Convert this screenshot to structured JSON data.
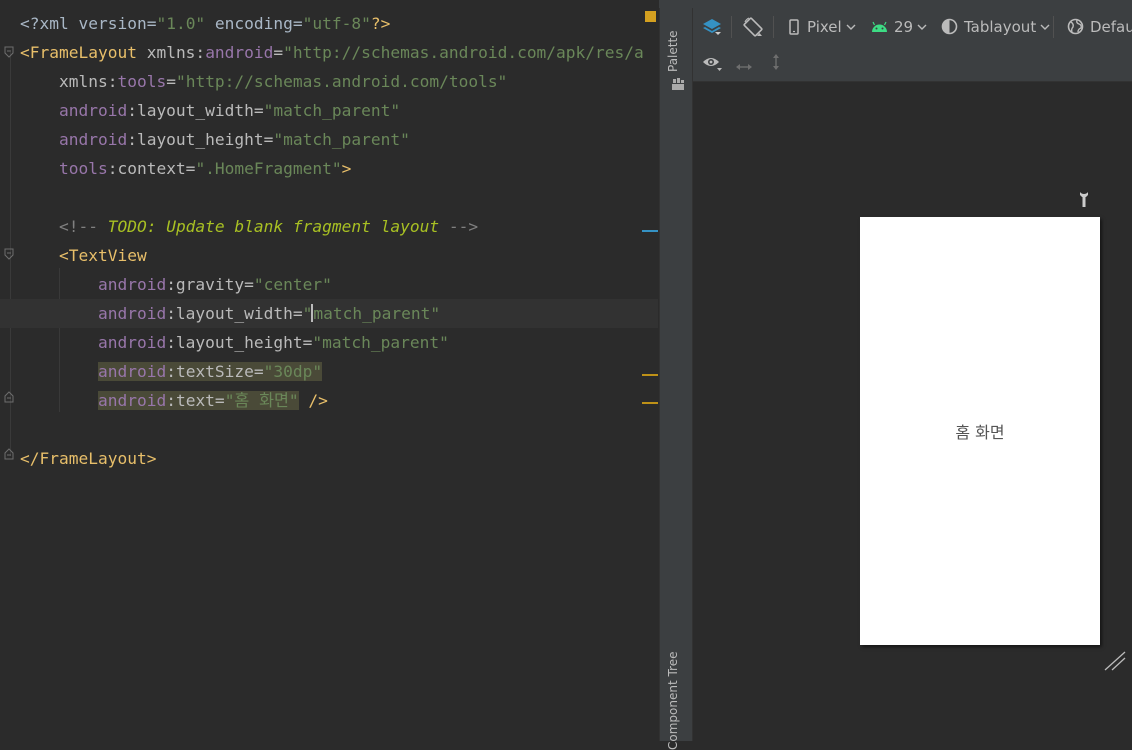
{
  "editor": {
    "lines": [
      {
        "parts": [
          [
            "t-plain",
            "<?"
          ],
          [
            "t-plain",
            "xml version="
          ],
          [
            "t-str",
            "\"1.0\""
          ],
          [
            "t-plain",
            " encoding="
          ],
          [
            "t-str",
            "\"utf-8\""
          ],
          [
            "t-tag",
            "?>"
          ]
        ]
      },
      {
        "parts": [
          [
            "t-tag",
            "<FrameLayout "
          ],
          [
            "t-attr",
            "xmlns:"
          ],
          [
            "t-ns",
            "android"
          ],
          [
            "t-attr",
            "="
          ],
          [
            "t-str",
            "\"http://schemas.android.com/apk/res/a"
          ]
        ]
      },
      {
        "parts": [
          [
            "t-attr",
            "    xmlns:"
          ],
          [
            "t-ns",
            "tools"
          ],
          [
            "t-attr",
            "="
          ],
          [
            "t-str",
            "\"http://schemas.android.com/tools\""
          ]
        ]
      },
      {
        "parts": [
          [
            "t-ns",
            "    android"
          ],
          [
            "t-attr",
            ":layout_width="
          ],
          [
            "t-str",
            "\"match_parent\""
          ]
        ]
      },
      {
        "parts": [
          [
            "t-ns",
            "    android"
          ],
          [
            "t-attr",
            ":layout_height="
          ],
          [
            "t-str",
            "\"match_parent\""
          ]
        ]
      },
      {
        "parts": [
          [
            "t-ns",
            "    tools"
          ],
          [
            "t-attr",
            ":context="
          ],
          [
            "t-str",
            "\".HomeFragment\""
          ],
          [
            "t-tag",
            ">"
          ]
        ]
      },
      {
        "parts": []
      },
      {
        "parts": [
          [
            "t-comment",
            "    <!-- "
          ],
          [
            "t-todo",
            "TODO: Update blank fragment layout"
          ],
          [
            "t-comment",
            " -->"
          ]
        ]
      },
      {
        "parts": [
          [
            "t-tag",
            "    <TextView"
          ]
        ]
      },
      {
        "parts": [
          [
            "t-ns",
            "        android"
          ],
          [
            "t-attr",
            ":gravity="
          ],
          [
            "t-str",
            "\"center\""
          ]
        ]
      },
      {
        "parts": [
          [
            "t-ns",
            "        android"
          ],
          [
            "t-attr",
            ":layout_width="
          ],
          [
            "t-str",
            "\""
          ],
          [
            "caret",
            ""
          ],
          [
            "t-str",
            "match_parent\""
          ]
        ]
      },
      {
        "parts": [
          [
            "t-ns",
            "        android"
          ],
          [
            "t-attr",
            ":layout_height="
          ],
          [
            "t-str",
            "\"match_parent\""
          ]
        ]
      },
      {
        "parts": [
          [
            "t-plain",
            "        "
          ],
          [
            "hl-ns",
            "android"
          ],
          [
            "hl-attr",
            ":textSize="
          ],
          [
            "hl-str",
            "\"30dp\""
          ]
        ]
      },
      {
        "parts": [
          [
            "t-plain",
            "        "
          ],
          [
            "hl-ns",
            "android"
          ],
          [
            "hl-attr",
            ":text="
          ],
          [
            "hl-str",
            "\"홈 화면\""
          ],
          [
            "t-tag",
            " />"
          ]
        ]
      },
      {
        "parts": []
      },
      {
        "parts": [
          [
            "t-tag",
            "</FrameLayout>"
          ]
        ]
      }
    ]
  },
  "side_strip": {
    "palette_label": "Palette",
    "component_tree_label": "Component Tree"
  },
  "toolbar": {
    "device": "Pixel",
    "api_level": "29",
    "theme": "Tablayout",
    "locale": "Default"
  },
  "preview": {
    "text": "홈 화면"
  }
}
